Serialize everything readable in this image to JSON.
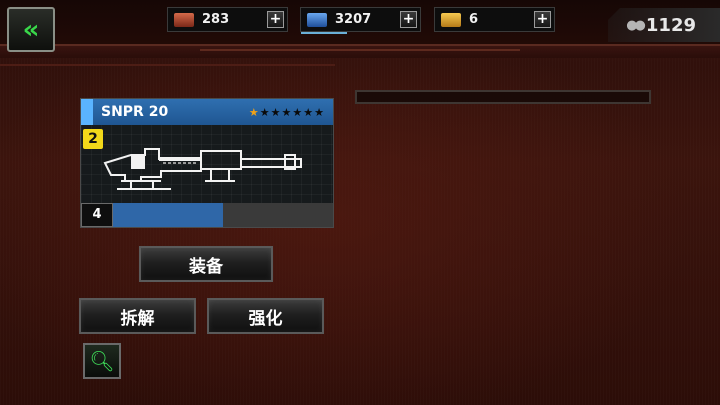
{
  "topbar": {
    "resources": [
      {
        "name": "supply",
        "value": "283",
        "color": "#c0533a",
        "icon": "crate-icon"
      },
      {
        "name": "parts",
        "value": "3207",
        "color": "#3f7fd0",
        "icon": "metal-block-icon"
      },
      {
        "name": "gold",
        "value": "6",
        "color": "#e0a12a",
        "icon": "gold-bars-icon"
      }
    ],
    "plus_label": "+",
    "coins": {
      "value": "1129",
      "icon_glyph": "●●"
    }
  },
  "back_glyph": "«",
  "weapon": {
    "name": "SNPR 20",
    "tier": "2",
    "stars_filled": 1,
    "stars_total": 7,
    "star_glyph": "★",
    "level": "4",
    "xp_progress": 0.5,
    "accent_color": "#2f6fb0"
  },
  "actions": {
    "equip": "装备",
    "dismantle": "拆解",
    "upgrade": "强化"
  }
}
